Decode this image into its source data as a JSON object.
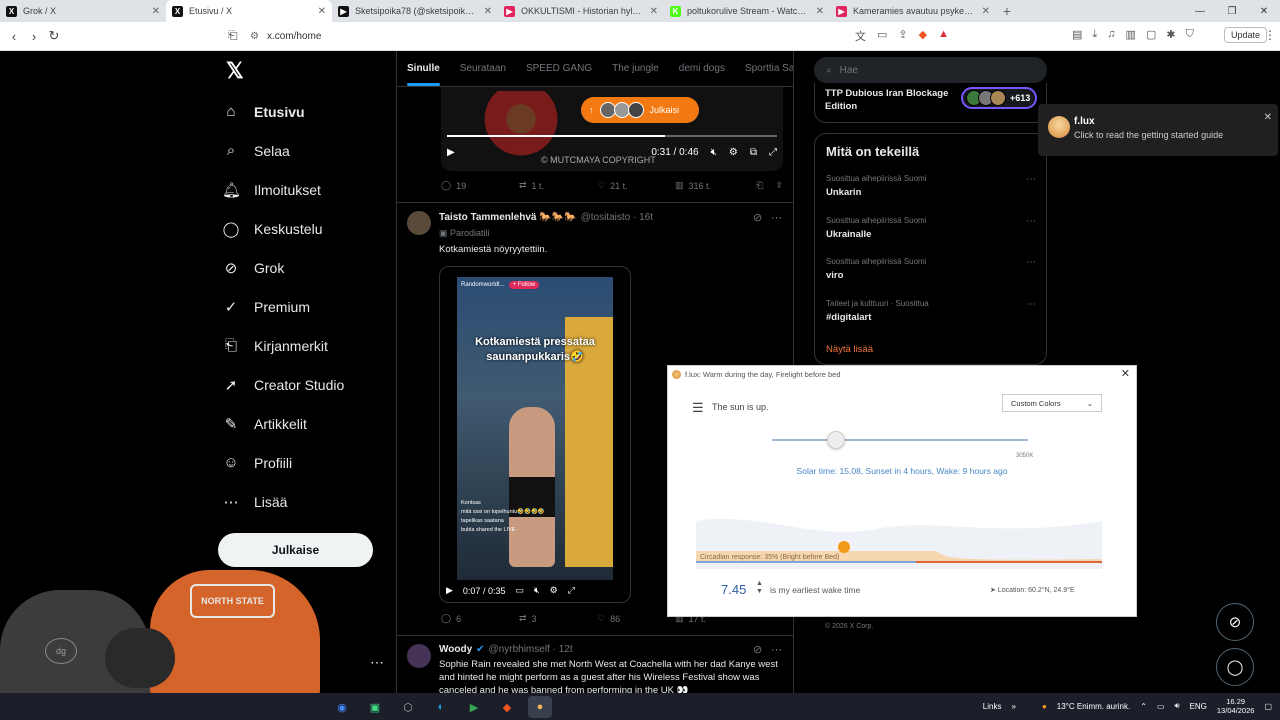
{
  "browser": {
    "tabs": [
      {
        "label": "Grok / X",
        "icon": "x-icon",
        "color": "#111"
      },
      {
        "label": "Etusivu / X",
        "icon": "x-icon",
        "color": "#111",
        "active": true
      },
      {
        "label": "Sketsipoika78 (@sketsipoika78) | TikT",
        "icon": "tiktok-icon",
        "color": "#111"
      },
      {
        "label": "OKKULTISMI - Historian hylätty totuu",
        "icon": "youtube-icon",
        "color": "#e0245e"
      },
      {
        "label": "poltukorulive Stream - Watch Live o",
        "icon": "kick-icon",
        "color": "#53fc18"
      },
      {
        "label": "Kameramies avautuu psykedeelisistä",
        "icon": "youtube-icon",
        "color": "#e0245e"
      }
    ],
    "url": "x.com/home",
    "update_label": "Update"
  },
  "sidebar": {
    "items": [
      {
        "label": "Etusivu",
        "icon": "⌂",
        "name": "home"
      },
      {
        "label": "Selaa",
        "icon": "⌕",
        "name": "explore"
      },
      {
        "label": "Ilmoitukset",
        "icon": "🔔︎",
        "name": "notifications"
      },
      {
        "label": "Keskustelu",
        "icon": "◯",
        "name": "chat"
      },
      {
        "label": "Grok",
        "icon": "⊘",
        "name": "grok"
      },
      {
        "label": "Premium",
        "icon": "✓",
        "name": "premium"
      },
      {
        "label": "Kirjanmerkit",
        "icon": "⎗",
        "name": "bookmarks"
      },
      {
        "label": "Creator Studio",
        "icon": "➚",
        "name": "creator-studio"
      },
      {
        "label": "Artikkelit",
        "icon": "✎",
        "name": "articles"
      },
      {
        "label": "Profiili",
        "icon": "☺",
        "name": "profile"
      },
      {
        "label": "Lisää",
        "icon": "⋯",
        "name": "more"
      }
    ],
    "post_button": "Julkaise"
  },
  "feed": {
    "tabs": [
      "Sinulle",
      "Seurataan",
      "SPEED GANG",
      "The jungle",
      "demi dogs",
      "Sporttia Sa"
    ],
    "new_posts_pill": "Julkaisi",
    "video1": {
      "time": "0:31 / 0:46",
      "watermark": "© MUTCMAYA COPYRIGHT"
    },
    "tweet1_actions": {
      "replies": "19",
      "reposts": "1 t.",
      "likes": "21 t.",
      "views": "316 t."
    },
    "tweet2": {
      "name": "Taisto Tammenlehvä 🐎🐎🐎",
      "handle": "@tositaisto · 16t",
      "label": "Parodiatili",
      "text": "Kotkamiestä nöyryytettiin.",
      "video_caption": "Kotkamiestä pressataa saunanpukkaris🤣",
      "video_top": "Randomworldt...",
      "video_follow": "+ Follow",
      "video_chat": "Kontsas\nmitä sssi on topelhuntu🤣🤣🤣🤣\ntapelikas saatana\nbubla shared the LIVE",
      "time": "0:07 / 0:35",
      "actions": {
        "replies": "6",
        "reposts": "3",
        "likes": "86",
        "views": "17 t."
      }
    },
    "tweet3": {
      "name": "Woody",
      "handle": "@nyrbhimself · 12t",
      "text": "Sophie Rain revealed she met North West at Coachella with her dad Kanye west and hinted he might perform as a guest after his Wireless Festival show was canceled and he was banned from performing in the UK 👀"
    }
  },
  "right": {
    "search_placeholder": "Hae",
    "live_title": "TTP Dubious Iran Blockage Edition",
    "live_count": "+613",
    "whats_happening": "Mitä on tekeillä",
    "trends": [
      {
        "context": "Suosittua aihepiirissä Suomi",
        "name": "Unkarin"
      },
      {
        "context": "Suosittua aihepiirissä Suomi",
        "name": "Ukrainalle"
      },
      {
        "context": "Suosittua aihepiirissä Suomi",
        "name": "viro"
      },
      {
        "context": "Taiteet ja kulttuuri · Suosittua",
        "name": "#digitalart"
      }
    ],
    "show_more": "Näytä lisää",
    "copyright": "© 2026 X Corp."
  },
  "toast": {
    "title": "f.lux",
    "body": "Click to read the getting started guide"
  },
  "flux": {
    "title": "f.lux: Warm during the day, Firelight before bed",
    "status": "The sun is up.",
    "preset": "Custom Colors",
    "kelvin": "3050K",
    "slider_value": 0.25,
    "solar": "Solar time: 15.08, Sunset in 4 hours, Wake: 9 hours ago",
    "circadian": "Circadian response: 35% (Bright before Bed)",
    "wake_time": "7.45",
    "wake_label": "is my earliest wake time",
    "location": "Location: 60.2°N, 24.9°E"
  },
  "taskbar": {
    "links": "Links",
    "weather": "13°C  Enimm. aurink.",
    "lang": "ENG",
    "time": "16.29",
    "date": "13/04/2026"
  },
  "webcam": {
    "cap_text": "NORTH STATE",
    "bg_logo": "dg"
  }
}
